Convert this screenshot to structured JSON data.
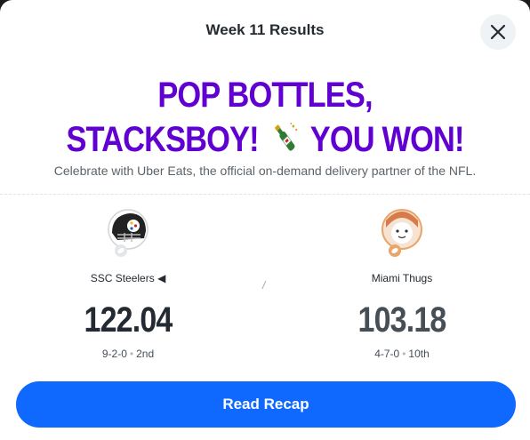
{
  "header": {
    "title": "Week 11 Results",
    "close_icon": "close-icon"
  },
  "headline": {
    "line1": "POP BOTTLES, STACKSBOY!",
    "line2": "YOU WON!",
    "emoji_icon": "champagne-bottle-icon"
  },
  "subtitle": "Celebrate with Uber Eats, the official on-demand delivery partner of the NFL.",
  "matchup": {
    "separator": "/",
    "home": {
      "name": "SSC Steelers",
      "marker": "◀",
      "score": "122.04",
      "record": "9-2-0",
      "rank": "2nd",
      "logo_icon": "steelers-helmet-icon"
    },
    "away": {
      "name": "Miami Thugs",
      "score": "103.18",
      "record": "4-7-0",
      "rank": "10th",
      "logo_icon": "cartoon-avatar-icon"
    }
  },
  "cta": {
    "label": "Read Recap"
  },
  "colors": {
    "accent": "#6001d2",
    "button": "#0f69ff",
    "text": "#232a31"
  }
}
